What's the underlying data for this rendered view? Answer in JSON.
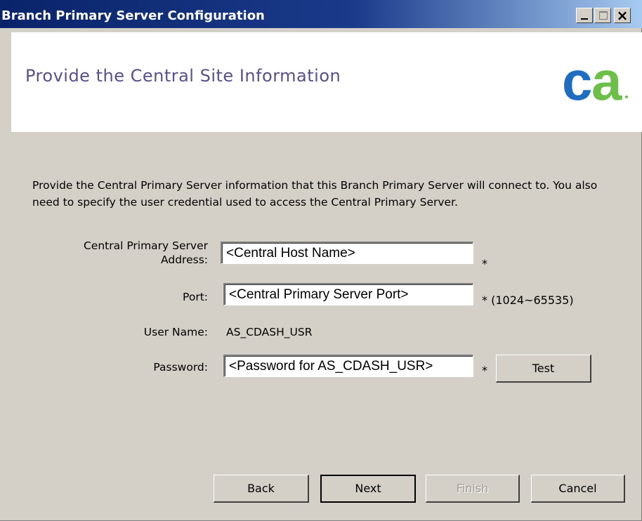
{
  "window": {
    "title": "Branch Primary Server Configuration"
  },
  "header": {
    "title": "Provide the Central Site Information",
    "logo_text": "ca"
  },
  "description": "Provide the Central Primary Server information that this Branch Primary Server will connect to. You also need to specify the user credential used to access the Central Primary Server.",
  "form": {
    "address": {
      "label": "Central Primary Server Address:",
      "value": "<Central Host Name>",
      "required_mark": "*"
    },
    "port": {
      "label": "Port:",
      "value": "<Central Primary Server Port>",
      "required_mark": "* (1024~65535)"
    },
    "user": {
      "label": "User Name:",
      "value": "AS_CDASH_USR"
    },
    "password": {
      "label": "Password:",
      "value": "<Password for AS_CDASH_USR>",
      "required_mark": "*"
    },
    "test_label": "Test"
  },
  "buttons": {
    "back": "Back",
    "next": "Next",
    "finish": "Finish",
    "cancel": "Cancel"
  },
  "colors": {
    "titlebar_start": "#0a246a",
    "titlebar_end": "#a6caf0",
    "header_title": "#5a4f8a",
    "logo_blue": "#1f6dc1",
    "logo_green": "#6cc04a",
    "dialog_bg": "#d4d0c8"
  },
  "icons": [
    "minimize-icon",
    "maximize-icon",
    "close-icon",
    "ca-logo"
  ]
}
